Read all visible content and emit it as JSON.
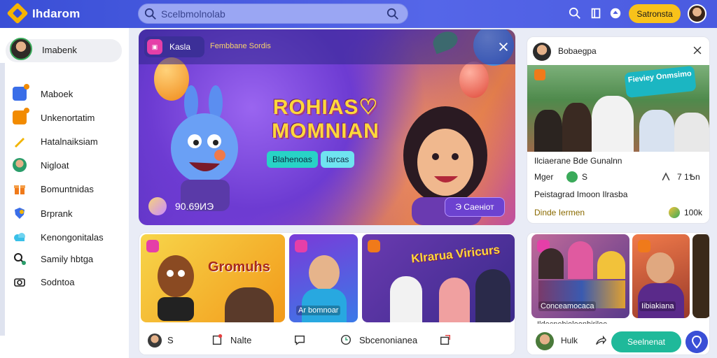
{
  "app": {
    "title": "Ihdarom"
  },
  "search": {
    "placeholder": "Scelbmolnolab"
  },
  "header": {
    "cta_label": "Satronsta"
  },
  "sidebar": {
    "profile_name": "Imabenk",
    "items": [
      {
        "label": "Maboek",
        "icon": "news-icon",
        "color": "#3a6ee8"
      },
      {
        "label": "Unkenortatim",
        "icon": "pages-icon",
        "color": "#f28b00"
      },
      {
        "label": "Hatalnaiksiam",
        "icon": "pencil-icon",
        "color": "#f2b400"
      },
      {
        "label": "Nigloat",
        "icon": "profile-icon",
        "color": "#2a9d6a"
      },
      {
        "label": "Bomuntnidas",
        "icon": "gift-icon",
        "color": "#f07a1a"
      },
      {
        "label": "Brprank",
        "icon": "shield-icon",
        "color": "#3a6ee8"
      },
      {
        "label": "Kenongonitalas",
        "icon": "cloud-icon",
        "color": "#3ac0e8"
      },
      {
        "label": "Samily hbtga",
        "icon": "search-icon",
        "color": "#2a9d6a"
      },
      {
        "label": "Sodntoa",
        "icon": "camera-icon",
        "color": "#3a6ee8"
      }
    ]
  },
  "hero": {
    "chip_label": "Kasla",
    "subtitle": "Fembbane Sordis",
    "title_line1": "ROHIAS♡",
    "title_line2": "MOMNIAN",
    "tag1": "Blahenoas",
    "tag2": "Iarcas",
    "views": "90.69ИЭ",
    "button_label": "Э Саеніот"
  },
  "side_post": {
    "author": "Bobaegpa",
    "photo_tag": "Fieviey Onmsimo",
    "caption": "Ilciaerane Bde Gunalnn",
    "row1_left": "Mger",
    "row1_mid": "S",
    "row1_right": "7 1Ѣn",
    "row2": "Peistagrad Imoon Ilrasba",
    "row3_left": "Dinde Iermen",
    "row3_right": "100k"
  },
  "grid": {
    "tile1_title": "Gromuhs",
    "tile2_caption": "Ar bomnoar",
    "tile3_title": "Klrarua Viricurs",
    "footer": [
      {
        "icon": "avatar-icon",
        "label": "S"
      },
      {
        "icon": "bookmark-icon",
        "label": "Nalte"
      },
      {
        "icon": "comment-icon",
        "label": ""
      },
      {
        "icon": "clock-icon",
        "label": "Sbcenonianea"
      },
      {
        "icon": "share-icon",
        "label": ""
      }
    ]
  },
  "side2": {
    "tile_caption": "Conceamocaca",
    "tile2_caption": "Iibiakiana",
    "small_caption": "Ildecnebioloonbiriloe",
    "user": "Hulk",
    "button_label": "Seelnenat"
  }
}
